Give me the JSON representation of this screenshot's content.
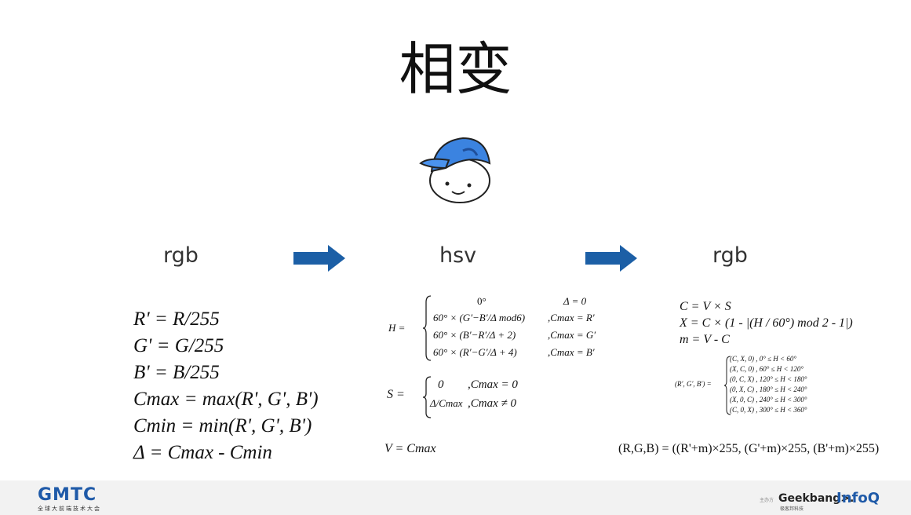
{
  "title": "相变",
  "columns": {
    "left": "rgb",
    "middle": "hsv",
    "right": "rgb"
  },
  "left_formulas": [
    "R' = R/255",
    "G' = G/255",
    "B' = B/255",
    "Cmax = max(R', G', B')",
    "Cmin = min(R', G', B')",
    "Δ = Cmax - Cmin"
  ],
  "hue": {
    "lhs": "H =",
    "rows": [
      {
        "expr": "0°",
        "cond": "Δ = 0"
      },
      {
        "expr": "60° × (G′−B′/Δ mod6)",
        "cond": ",Cmax = R′"
      },
      {
        "expr": "60° × (B′−R′/Δ + 2)",
        "cond": ",Cmax = G′"
      },
      {
        "expr": "60° × (R′−G′/Δ + 4)",
        "cond": ",Cmax = B′"
      }
    ]
  },
  "saturation": {
    "lhs": "S =",
    "rows": [
      {
        "expr": "0",
        "cond": ",Cmax = 0"
      },
      {
        "expr": "Δ/Cmax",
        "cond": ",Cmax ≠ 0"
      }
    ]
  },
  "value_formula": "V = Cmax",
  "right_formulas": [
    "C = V × S",
    "X = C × (1 - |(H / 60°) mod 2 - 1|)",
    "m = V - C"
  ],
  "rgb_prime": {
    "lhs": "(R′, G′, B′) =",
    "rows": [
      {
        "tuple": "(C, X, 0)",
        "cond": ", 0° ≤ H < 60°"
      },
      {
        "tuple": "(X, C, 0)",
        "cond": ", 60° ≤ H < 120°"
      },
      {
        "tuple": "(0, C, X)",
        "cond": ", 120° ≤ H < 180°"
      },
      {
        "tuple": "(0, X, C)",
        "cond": ", 180° ≤ H < 240°"
      },
      {
        "tuple": "(X, 0, C)",
        "cond": ", 240° ≤ H < 300°"
      },
      {
        "tuple": "(C, 0, X)",
        "cond": ", 300° ≤ H < 360°"
      }
    ]
  },
  "final_formula": "(R,G,B) = ((R'+m)×255, (G'+m)×255, (B'+m)×255)",
  "footer": {
    "brand": "GMTC",
    "brand_sub": "全球大前端技术大会",
    "organizer": "主办方",
    "geekbang": "Geekbang>.",
    "geekbang_sub": "极客邦科技",
    "infoq": "InfoQ"
  },
  "colors": {
    "arrow": "#1c5fa6",
    "brand": "#1f5aa8",
    "cap": "#3b83e0"
  }
}
